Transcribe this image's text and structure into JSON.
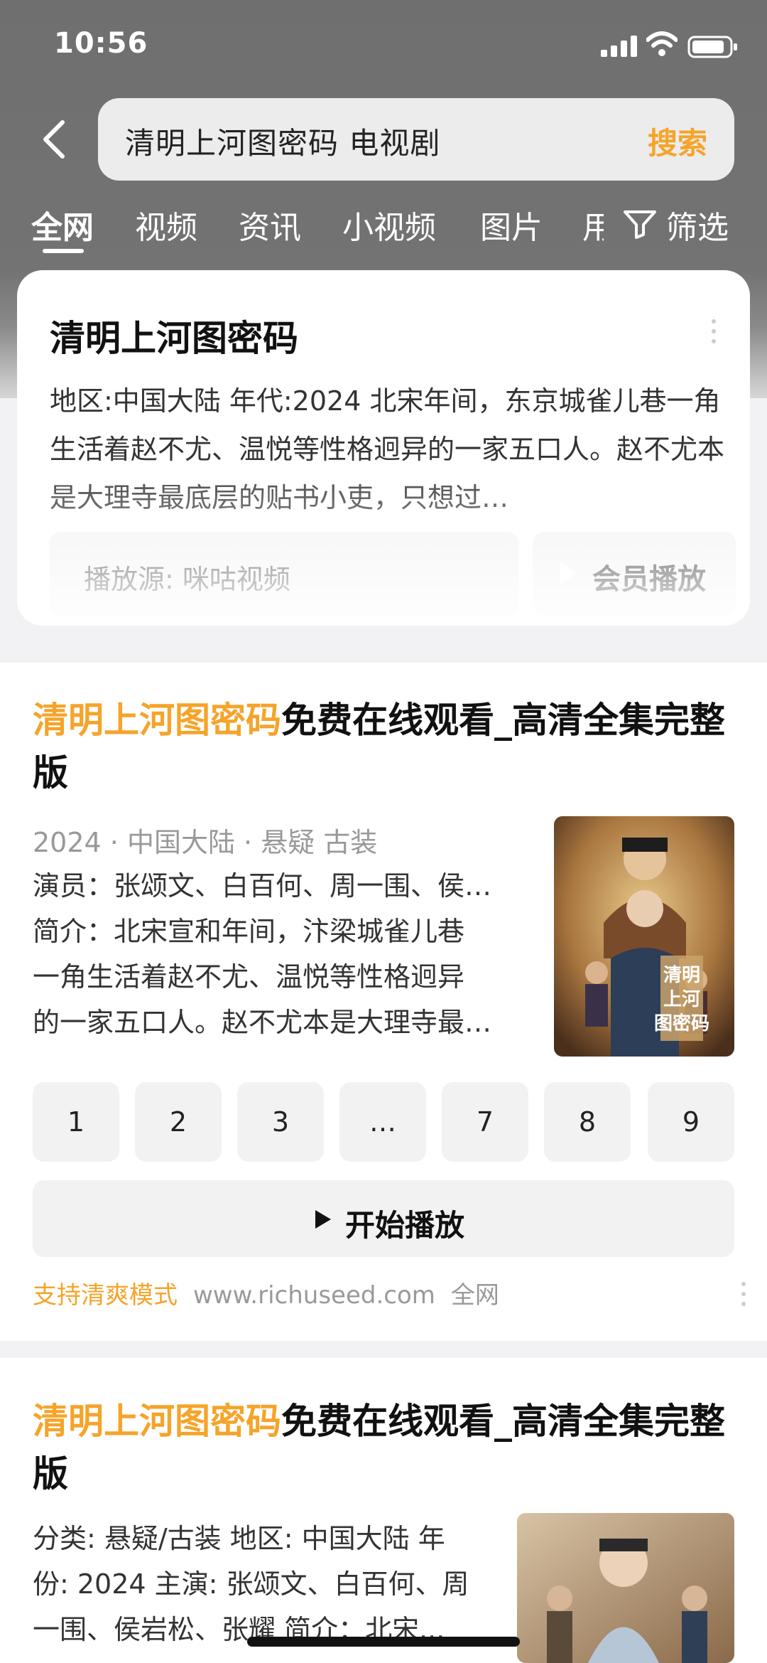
{
  "status": {
    "time": "10:56"
  },
  "search": {
    "query": "清明上河图密码 电视剧",
    "button": "搜索"
  },
  "tabs": [
    "全网",
    "视频",
    "资讯",
    "小视频",
    "图片",
    "用"
  ],
  "filter_label": "筛选",
  "feature_card": {
    "title": "清明上河图密码",
    "description": "地区:中国大陆 年代:2024 北宋年间，东京城雀儿巷一角生活着赵不尤、温悦等性格迥异的一家五口人。赵不尤本是大理寺最底层的贴书小吏，只想过…",
    "source": "播放源: 咪咕视频",
    "play_button": "会员播放"
  },
  "result1": {
    "title_highlight": "清明上河图密码",
    "title_rest": "免费在线观看_高清全集完整版",
    "meta": "2024 · 中国大陆 · 悬疑 古装",
    "cast": "演员：张颂文、白百何、周一围、侯…",
    "intro_lines": [
      "简介：北宋宣和年间，汴梁城雀儿巷",
      "一角生活着赵不尤、温悦等性格迥异",
      "的一家五口人。赵不尤本是大理寺最…"
    ],
    "episodes": [
      "1",
      "2",
      "3",
      "…",
      "7",
      "8",
      "9"
    ],
    "start_button": "开始播放",
    "footer_tag": "支持清爽模式",
    "footer_site": "www.richuseed.com",
    "footer_scope": "全网",
    "poster_title": "清明上河图密码"
  },
  "result2": {
    "title_highlight": "清明上河图密码",
    "title_rest": "免费在线观看_高清全集完整版",
    "info_lines": [
      "分类: 悬疑/古装 地区: 中国大陆 年",
      "份: 2024 主演: 张颂文、白百何、周",
      "一围、侯岩松、张耀 简介：北宋..."
    ]
  },
  "colors": {
    "accent": "#f5a42a",
    "header_gray": "#737373",
    "tile_bg": "#f2f2f2"
  }
}
